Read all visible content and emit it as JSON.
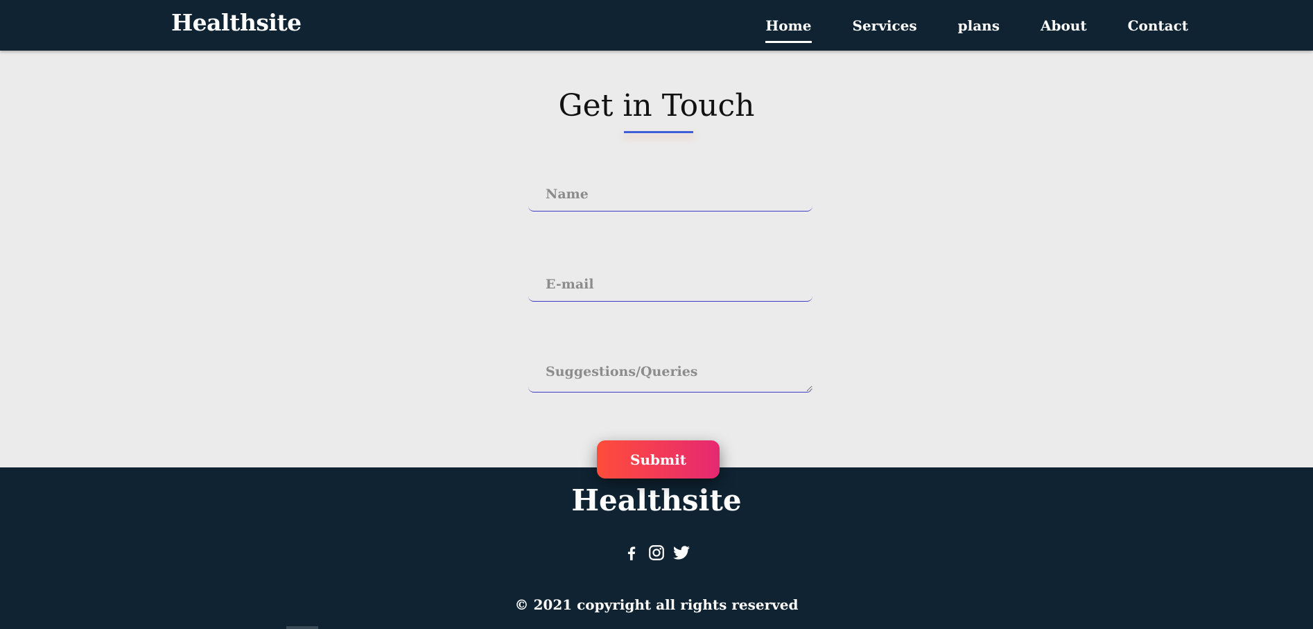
{
  "nav": {
    "brand": "Healthsite",
    "links": [
      "Home",
      "Services",
      "plans",
      "About",
      "Contact"
    ],
    "active": "Home"
  },
  "contact": {
    "title": "Get in Touch",
    "name_placeholder": "Name",
    "email_placeholder": "E-mail",
    "query_placeholder": "Suggestions/Queries",
    "submit_label": "Submit"
  },
  "footer": {
    "brand": "Healthsite",
    "social_icons": [
      "facebook-icon",
      "instagram-icon",
      "twitter-icon"
    ],
    "copyright": "© 2021 copyright all rights reserved"
  },
  "colors": {
    "navbar_bg": "#0f2332",
    "page_bg": "#ebebeb",
    "accent_underline": "#3f5ed8",
    "button_gradient_start": "#ff4d3a",
    "button_gradient_end": "#e62872"
  }
}
